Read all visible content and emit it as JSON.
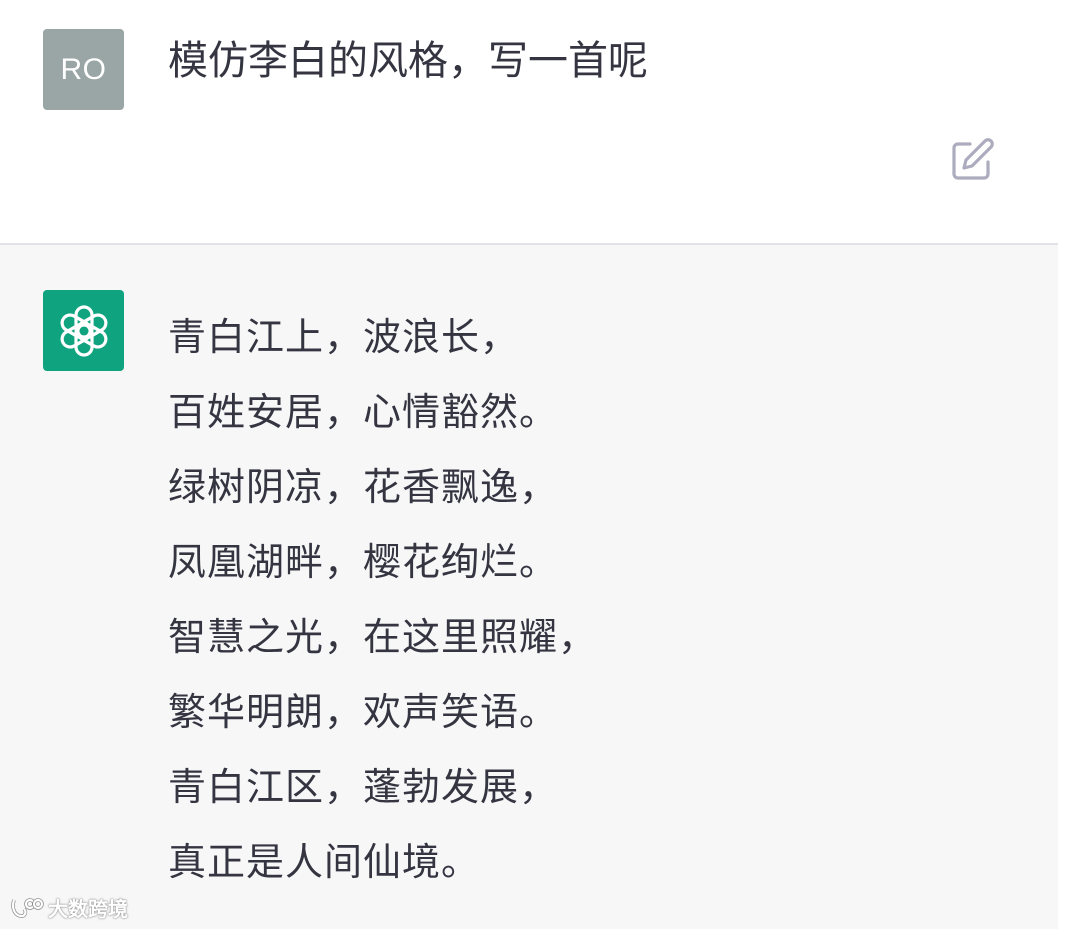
{
  "user_message": {
    "avatar_initials": "RO",
    "text": "模仿李白的风格，写一首呢"
  },
  "assistant_message": {
    "avatar_icon": "openai-logo-icon",
    "lines": [
      "青白江上，波浪长，",
      "百姓安居，心情豁然。",
      "绿树阴凉，花香飘逸，",
      "凤凰湖畔，樱花绚烂。",
      "智慧之光，在这里照耀，",
      "繁华明朗，欢声笑语。",
      "青白江区，蓬勃发展，",
      "真正是人间仙境。"
    ]
  },
  "watermark": {
    "text": "大数跨境"
  },
  "colors": {
    "user_avatar_bg": "#9aa5a5",
    "assistant_avatar_bg": "#10a37f",
    "assistant_panel_bg": "#f7f7f8",
    "text": "#343541",
    "edit_icon": "#acacbe"
  }
}
